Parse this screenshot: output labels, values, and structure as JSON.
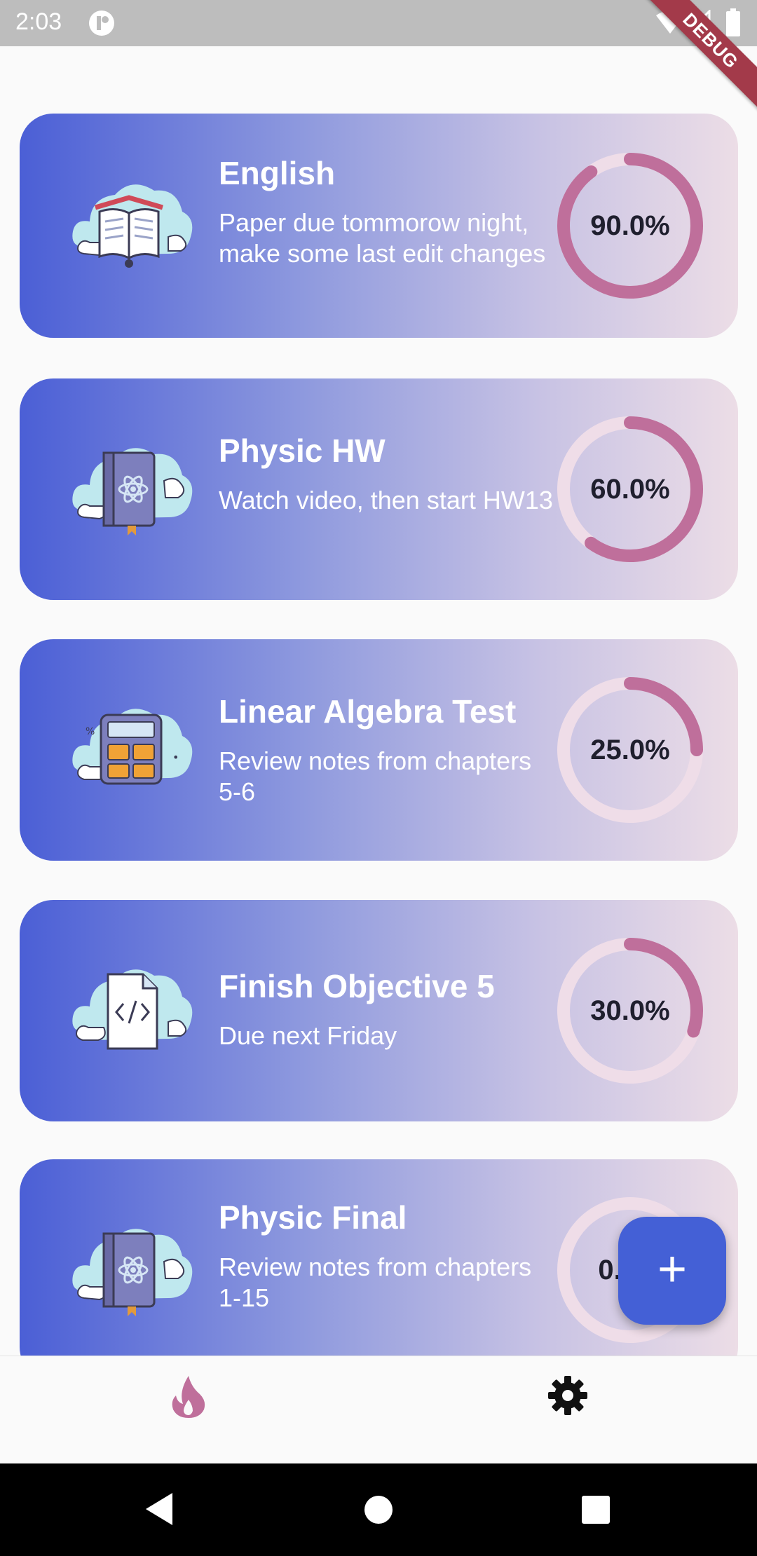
{
  "status_bar": {
    "time": "2:03"
  },
  "debug_banner": "DEBUG",
  "tasks": [
    {
      "title": "English",
      "description": "Paper due tommorow night, make some last edit changes",
      "icon": "book-icon",
      "progress": 0.9,
      "progress_label": "90.0%"
    },
    {
      "title": "Physic HW",
      "description": "Watch video, then start HW13",
      "icon": "physics-book-icon",
      "progress": 0.6,
      "progress_label": "60.0%"
    },
    {
      "title": "Linear Algebra Test",
      "description": "Review notes from chapters 5-6",
      "icon": "calculator-icon",
      "progress": 0.25,
      "progress_label": "25.0%"
    },
    {
      "title": "Finish Objective 5",
      "description": "Due next Friday",
      "icon": "code-file-icon",
      "progress": 0.3,
      "progress_label": "30.0%"
    },
    {
      "title": "Physic Final",
      "description": "Review notes from chapters 1-15",
      "icon": "physics-book-icon",
      "progress": 0.0,
      "progress_label": "0.0%"
    }
  ],
  "fab": {
    "icon": "plus-icon",
    "symbol": "+"
  },
  "bottom_nav": [
    {
      "icon": "fire-icon",
      "active": true
    },
    {
      "icon": "gear-icon",
      "active": false
    }
  ],
  "colors": {
    "accent": "#4460d6",
    "progress_arc": "#bf6f9b",
    "progress_track": "#efdde8",
    "card_gradient_start": "#4b5fd6",
    "card_gradient_end": "#ecdde6"
  }
}
